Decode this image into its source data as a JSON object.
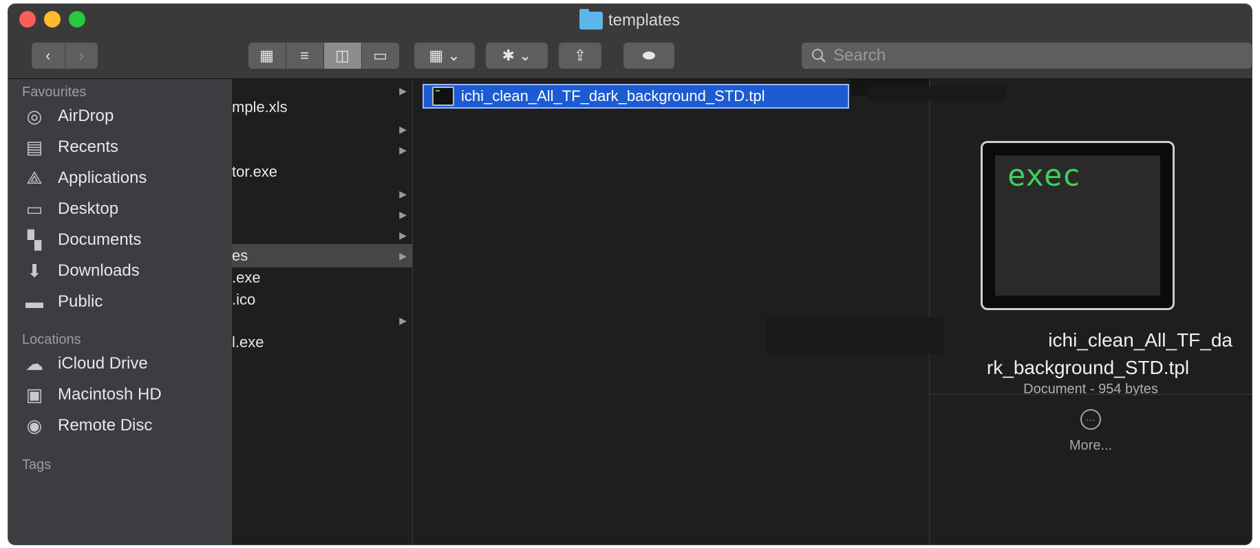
{
  "window": {
    "title": "templates"
  },
  "toolbar": {
    "back": "‹",
    "forward": "›",
    "view_icons": "▦",
    "view_list": "≡",
    "view_columns": "◫",
    "view_gallery": "▭",
    "group": "▦ ⌄",
    "action": "✱ ⌄",
    "share": "⇪",
    "tags": "⬬",
    "search_placeholder": "Search"
  },
  "sidebar": {
    "favourites_header": "Favourites",
    "favourites": [
      {
        "label": "AirDrop",
        "icon": "airdrop-icon",
        "glyph": "◎"
      },
      {
        "label": "Recents",
        "icon": "recents-icon",
        "glyph": "▤"
      },
      {
        "label": "Applications",
        "icon": "applications-icon",
        "glyph": "⟁"
      },
      {
        "label": "Desktop",
        "icon": "desktop-icon",
        "glyph": "▭"
      },
      {
        "label": "Documents",
        "icon": "documents-icon",
        "glyph": "▚"
      },
      {
        "label": "Downloads",
        "icon": "downloads-icon",
        "glyph": "⬇"
      },
      {
        "label": "Public",
        "icon": "public-folder-icon",
        "glyph": "▬"
      }
    ],
    "locations_header": "Locations",
    "locations": [
      {
        "label": "iCloud Drive",
        "icon": "icloud-icon",
        "glyph": "☁"
      },
      {
        "label": "Macintosh HD",
        "icon": "harddisk-icon",
        "glyph": "▣"
      },
      {
        "label": "Remote Disc",
        "icon": "disc-icon",
        "glyph": "◉"
      }
    ],
    "tags_header": "Tags"
  },
  "column1": [
    {
      "label": "",
      "chevron": "▶"
    },
    {
      "label": "mple.xls",
      "chevron": ""
    },
    {
      "label": "",
      "chevron": "▶"
    },
    {
      "label": "",
      "chevron": "▶"
    },
    {
      "label": "tor.exe",
      "chevron": ""
    },
    {
      "label": "",
      "chevron": "▶"
    },
    {
      "label": "",
      "chevron": "▶"
    },
    {
      "label": "",
      "chevron": "▶"
    },
    {
      "label": "es",
      "chevron": "▶"
    },
    {
      "label": ".exe",
      "chevron": ""
    },
    {
      "label": ".ico",
      "chevron": ""
    },
    {
      "label": "",
      "chevron": "▶"
    },
    {
      "label": "l.exe",
      "chevron": ""
    }
  ],
  "column2": {
    "selected_file": "ichi_clean_All_TF_dark_background_STD.tpl"
  },
  "preview": {
    "thumbnail_text": "exec",
    "name_line1": "ichi_clean_All_TF_da",
    "name_line2": "rk_background_STD.tpl",
    "meta": "Document - 954 bytes",
    "more_label": "More...",
    "more_glyph": "···"
  }
}
